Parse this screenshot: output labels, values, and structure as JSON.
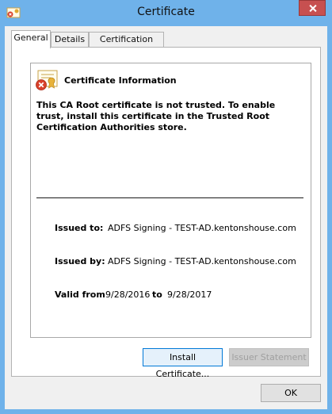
{
  "window": {
    "title": "Certificate"
  },
  "tabs": [
    {
      "label": "General",
      "active": true
    },
    {
      "label": "Details",
      "active": false
    },
    {
      "label": "Certification Path",
      "active": false
    }
  ],
  "info": {
    "title": "Certificate Information",
    "warning": "This CA Root certificate is not trusted. To enable trust, install this certificate in the Trusted Root Certification Authorities store.",
    "issued_to_label": "Issued to:",
    "issued_to_value": "ADFS Signing - TEST-AD.kentonshouse.com",
    "issued_by_label": "Issued by:",
    "issued_by_value": "ADFS Signing - TEST-AD.kentonshouse.com",
    "valid_from_label": "Valid from",
    "valid_from_value": "9/28/2016",
    "valid_to_label": "to",
    "valid_to_value": "9/28/2017"
  },
  "buttons": {
    "install": "Install Certificate...",
    "issuer_statement": "Issuer Statement",
    "ok": "OK"
  },
  "colors": {
    "titlebar": "#6fb2ea",
    "close": "#c75050",
    "dialog_bg": "#f0f0f0"
  }
}
